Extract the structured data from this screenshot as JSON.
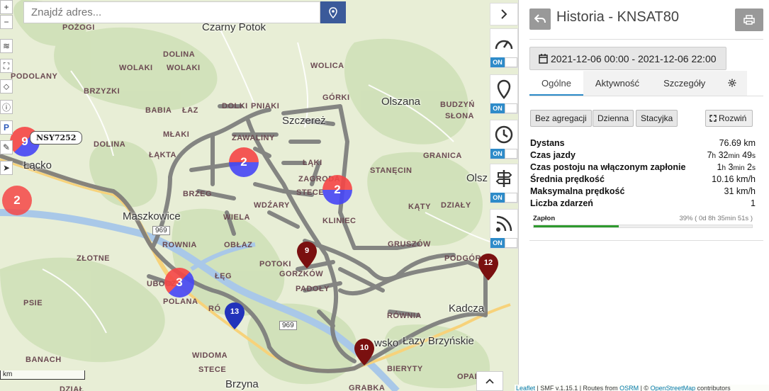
{
  "map": {
    "search_placeholder": "Znajdź adres...",
    "vehicle_label": "NSY7252",
    "road_number": "969",
    "scale_label": "km",
    "places": [
      "POŻOGI",
      "DOLINA",
      "WOLAKI",
      "WOLAKI",
      "PODOLANY",
      "BRZYZKI",
      "BABIA",
      "ŁAZ",
      "MŁAKI",
      "DOLINA",
      "ŁĄKTA",
      "DOLKI",
      "PNIAKI",
      "ZAWALINY",
      "ŁĄKI",
      "ZAGRODA",
      "STECE",
      "BRZEG",
      "WDŹARY",
      "WIELA",
      "KLINIEC",
      "ROWNIA",
      "OBŁAZ",
      "ŁĘG",
      "POTOKI",
      "GORZKÓW",
      "PADOŁY",
      "ZŁOTNE",
      "UBOCZ",
      "POLANA",
      "PSIE",
      "BANACH",
      "WIDOMA",
      "STECE",
      "DZIAŁ",
      "WOLICA",
      "GÓRKI",
      "BUDZYŃ",
      "SŁONA",
      "GRANICA",
      "STANĘCIN",
      "KĄTY",
      "DZIAŁY",
      "GRUSZÓW",
      "PODGÓR",
      "RÓWNIA",
      "BIERYTY",
      "OPAL",
      "GRABKA",
      "RÓ"
    ],
    "towns": [
      "Czarny Potok",
      "Szczereż",
      "Olszana",
      "Olsz",
      "Łącko",
      "Maszkowice",
      "Kadcza",
      "Łazy Brzyńskie",
      "Brzyna",
      "wsko"
    ],
    "clusters": [
      {
        "label": "9"
      },
      {
        "label": "2"
      },
      {
        "label": "2"
      },
      {
        "label": "2"
      },
      {
        "label": "3"
      }
    ],
    "pins": [
      "9",
      "12",
      "13",
      "10"
    ],
    "attribution": {
      "leaflet": "Leaflet",
      "middle": " | SMF v.1.15.1 | Routes from ",
      "osrm": "OSRM",
      "sep": " | © ",
      "osm": "OpenStreetMap",
      "end": " contributors"
    },
    "toggles": [
      "ON",
      "ON",
      "ON",
      "ON",
      "ON"
    ]
  },
  "panel": {
    "title": "Historia - KNSAT80",
    "date_range": "2021-12-06 00:00 - 2021-12-06 22:00",
    "tabs": [
      "Ogólne",
      "Aktywność",
      "Szczegóły"
    ],
    "aggregation": [
      "Bez agregacji",
      "Dzienna",
      "Stacyjka"
    ],
    "expand_label": "Rozwiń",
    "stats": [
      {
        "label": "Dystans",
        "value": "76.69 km"
      },
      {
        "label": "Czas jazdy",
        "h": "7",
        "m": "32",
        "s": "49"
      },
      {
        "label": "Czas postoju na włączonym zapłonie",
        "h": "1",
        "m": "3",
        "s": "2"
      },
      {
        "label": "Średnia prędkość",
        "value": "10.16 km/h"
      },
      {
        "label": "Maksymalna prędkość",
        "value": "31 km/h"
      },
      {
        "label": "Liczba zdarzeń",
        "value": "1"
      }
    ],
    "ignition": {
      "label": "Zapłon",
      "summary": "39% ( 0d 8h 35min 51s )",
      "percent": 39
    },
    "units": {
      "h": "h",
      "min": "min",
      "s": "s"
    }
  },
  "colors": {
    "accent": "#2e8bc9",
    "search_button": "#3b5a9a",
    "progress": "#2e9a2e",
    "route": "#7a7a7a",
    "pin": "#7a1010",
    "pin_blue": "#2233bb"
  }
}
